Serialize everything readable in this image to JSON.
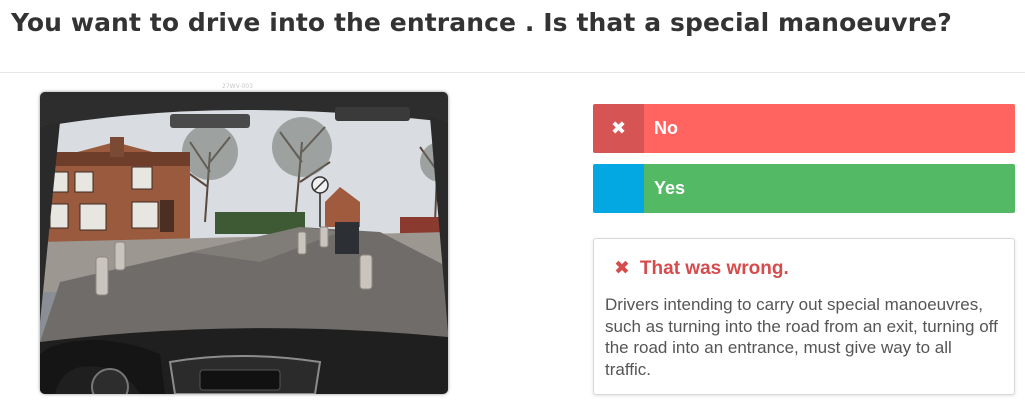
{
  "question": {
    "text": "You want to drive into the entrance . Is that a special manoeuvre?"
  },
  "image": {
    "caption": "27WV-003"
  },
  "answers": [
    {
      "label": "No",
      "icon": "close-icon",
      "state": "selected-wrong",
      "color": "#ff6461",
      "icon_color": "#d65454"
    },
    {
      "label": "Yes",
      "icon": "",
      "state": "unselected",
      "color": "#53b964",
      "icon_color": "#03a8e3"
    }
  ],
  "feedback": {
    "icon": "close-icon",
    "title": "That was wrong.",
    "body": "Drivers intending to carry out special manoeuvres, such as turning into the road from an exit, turning off the road into an entrance, must give way to all traffic.",
    "title_color": "#d64c4c"
  }
}
